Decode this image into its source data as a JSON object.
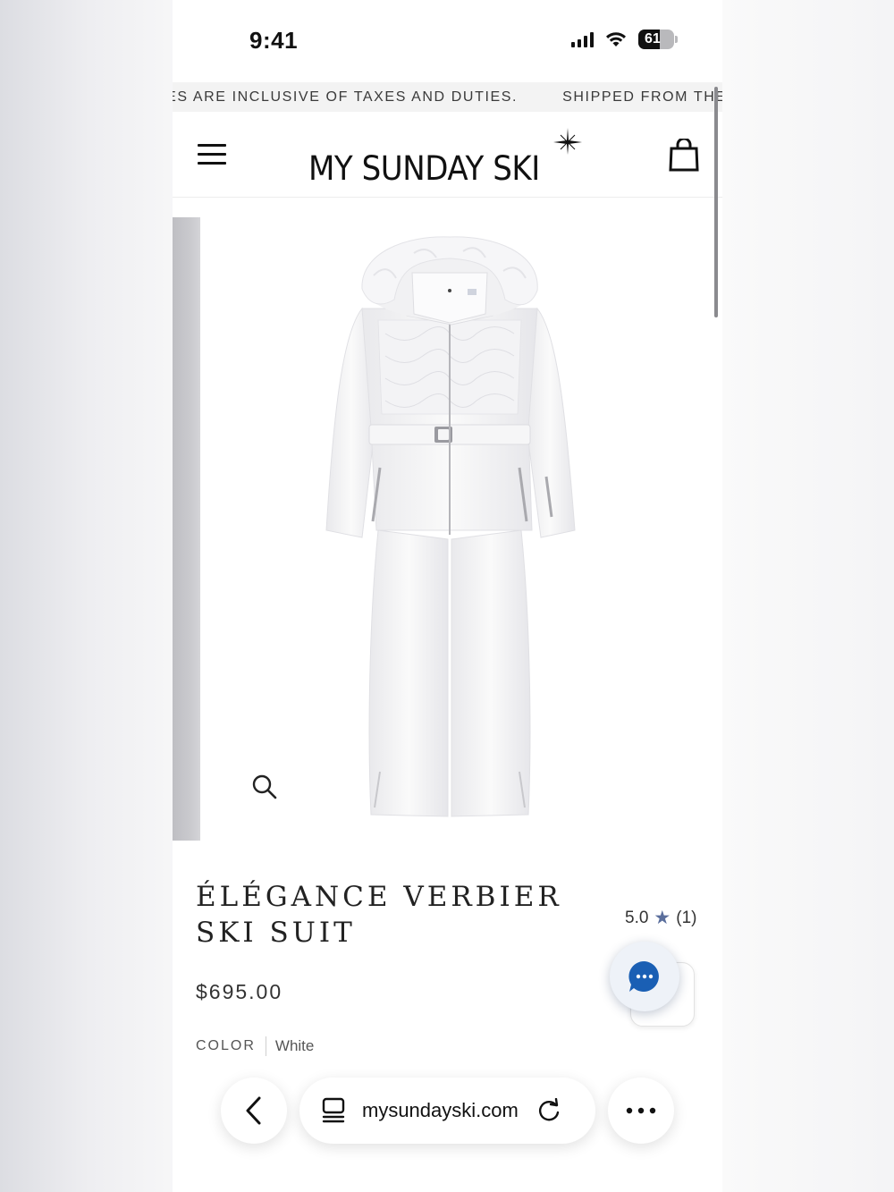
{
  "status_bar": {
    "time": "9:41",
    "battery_level": "61"
  },
  "announcement": {
    "items": [
      "CES ARE INCLUSIVE OF TAXES AND DUTIES.",
      "SHIPPED FROM THE"
    ]
  },
  "header": {
    "logo_text": "MY SUNDAY SKI",
    "menu_icon": "hamburger-icon",
    "cart_icon": "shopping-bag-icon"
  },
  "product": {
    "title": "ÉLÉGANCE VERBIER SKI SUIT",
    "rating": "5.0",
    "review_count": "(1)",
    "price": "$695.00",
    "color_label": "COLOR",
    "color_value": "White"
  },
  "browser": {
    "url": "mysundayski.com",
    "back_icon": "chevron-left-icon",
    "tabs_icon": "tabs-icon",
    "reload_icon": "reload-icon",
    "more_icon": "ellipsis-icon"
  },
  "colors": {
    "accent": "#1a5fb4",
    "text": "#222222",
    "star": "#5a6e9c"
  }
}
